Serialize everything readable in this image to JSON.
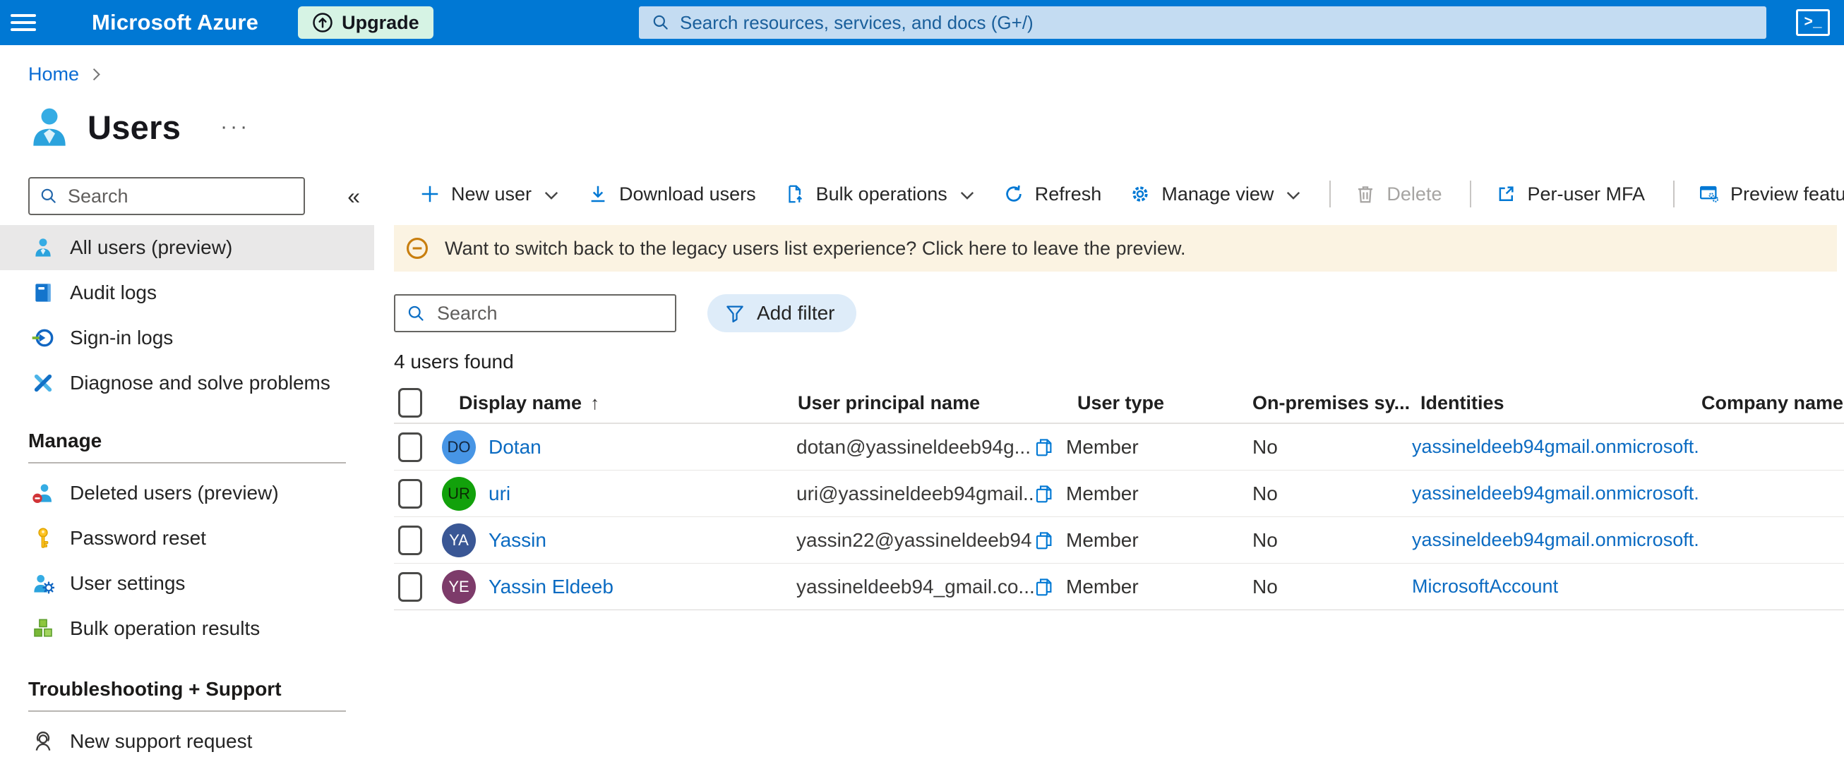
{
  "colors": {
    "topbar": "#0078d4",
    "upgrade_bg": "#d6f3e4",
    "topsearch_bg": "#c4dcf2",
    "link": "#0b6bc2",
    "toolbar_icon": "#0078d4",
    "disabled": "#a6a4a2",
    "selected_item_bg": "#e9e8e8",
    "banner_bg": "#fbf3e2",
    "banner_icon": "#c87e0e",
    "add_filter_bg": "#deecf9"
  },
  "topbar": {
    "brand": "Microsoft Azure",
    "upgrade_label": "Upgrade",
    "search_placeholder": "Search resources, services, and docs (G+/)",
    "cloud_shell_glyph": ">_"
  },
  "breadcrumb": {
    "home": "Home"
  },
  "page": {
    "title": "Users",
    "overflow_glyph": "···"
  },
  "sidebar": {
    "search_placeholder": "Search",
    "collapse_glyph": "«",
    "items": [
      {
        "label": "All users (preview)"
      },
      {
        "label": "Audit logs"
      },
      {
        "label": "Sign-in logs"
      },
      {
        "label": "Diagnose and solve problems"
      }
    ],
    "sections": [
      {
        "heading": "Manage",
        "items": [
          {
            "label": "Deleted users (preview)"
          },
          {
            "label": "Password reset"
          },
          {
            "label": "User settings"
          },
          {
            "label": "Bulk operation results"
          }
        ]
      },
      {
        "heading": "Troubleshooting + Support",
        "items": [
          {
            "label": "New support request"
          }
        ]
      }
    ]
  },
  "toolbar": {
    "new_user": "New user",
    "download_users": "Download users",
    "bulk_operations": "Bulk operations",
    "refresh": "Refresh",
    "manage_view": "Manage view",
    "delete": "Delete",
    "per_user_mfa": "Per-user MFA",
    "preview_features": "Preview features"
  },
  "banner": {
    "text": "Want to switch back to the legacy users list experience? Click here to leave the preview."
  },
  "filters": {
    "search_placeholder": "Search",
    "add_filter": "Add filter"
  },
  "summary": {
    "count_text": "4 users found"
  },
  "table": {
    "sort_arrow": "↑",
    "columns": [
      "Display name",
      "User principal name",
      "User type",
      "On-premises sy...",
      "Identities",
      "Company name"
    ],
    "rows": [
      {
        "initials": "DO",
        "avatar_style": "background:#4795e5;color:#12263e",
        "display_name": "Dotan",
        "upn": "dotan@yassineldeeb94g...",
        "user_type": "Member",
        "on_premises": "No",
        "identities": "yassineldeeb94gmail.onmicrosoft.",
        "company": ""
      },
      {
        "initials": "UR",
        "avatar_style": "background:#12a10b;color:#0a2904",
        "display_name": "uri",
        "upn": "uri@yassineldeeb94gmail....",
        "user_type": "Member",
        "on_premises": "No",
        "identities": "yassineldeeb94gmail.onmicrosoft.",
        "company": ""
      },
      {
        "initials": "YA",
        "avatar_style": "background:#3a5795;color:#ffffff",
        "display_name": "Yassin",
        "upn": "yassin22@yassineldeeb94...",
        "user_type": "Member",
        "on_premises": "No",
        "identities": "yassineldeeb94gmail.onmicrosoft.",
        "company": ""
      },
      {
        "initials": "YE",
        "avatar_style": "background:#7d3b6a;color:#ffffff",
        "display_name": "Yassin Eldeeb",
        "upn": "yassineldeeb94_gmail.co...",
        "user_type": "Member",
        "on_premises": "No",
        "identities": "MicrosoftAccount",
        "company": ""
      }
    ]
  }
}
